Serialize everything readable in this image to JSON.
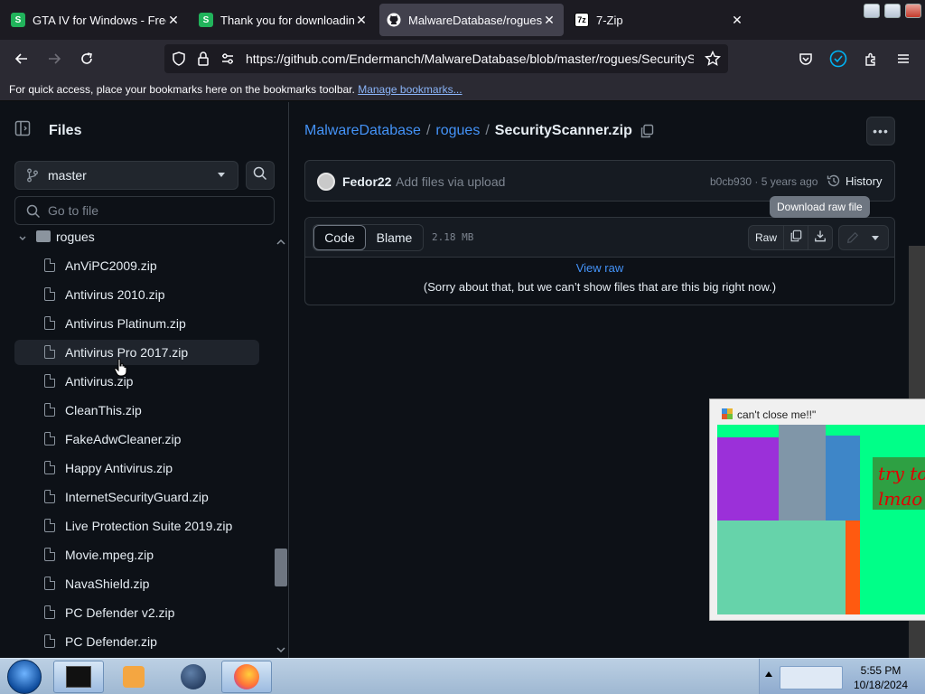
{
  "browser": {
    "tabs": [
      {
        "title": "GTA IV for Windows - Free d",
        "favicon": "s-green",
        "fav_color": "#21b35b"
      },
      {
        "title": "Thank you for downloading",
        "favicon": "s-green",
        "fav_color": "#21b35b"
      },
      {
        "title": "MalwareDatabase/rogues/Se",
        "favicon": "github-icon",
        "active": true
      },
      {
        "title": "7-Zip",
        "favicon": "7zip-icon"
      }
    ],
    "url_main": "https://github.com/Endermanch/MalwareDatabase/blob/master/rogues/SecuritySc",
    "bookmarks_text": "For quick access, place your bookmarks here on the bookmarks toolbar.",
    "bookmarks_link": "Manage bookmarks..."
  },
  "sidebar": {
    "title": "Files",
    "branch": "master",
    "goto_placeholder": "Go to file",
    "folder": "rogues",
    "files": [
      "AnViPC2009.zip",
      "Antivirus 2010.zip",
      "Antivirus Platinum.zip",
      "Antivirus Pro 2017.zip",
      "Antivirus.zip",
      "CleanThis.zip",
      "FakeAdwCleaner.zip",
      "Happy Antivirus.zip",
      "InternetSecurityGuard.zip",
      "Live Protection Suite 2019.zip",
      "Movie.mpeg.zip",
      "NavaShield.zip",
      "PC Defender v2.zip",
      "PC Defender.zip"
    ],
    "hovered_index": 3
  },
  "main": {
    "breadcrumb": {
      "repo": "MalwareDatabase",
      "sep": "/",
      "folder": "rogues",
      "file": "SecurityScanner.zip"
    },
    "commit": {
      "author": "Fedor22",
      "message": "Add files via upload",
      "sha_time": "b0cb930 · 5 years ago",
      "history": "History"
    },
    "tooltip": "Download raw file",
    "file": {
      "tab_code": "Code",
      "tab_blame": "Blame",
      "size": "2.18 MB",
      "raw": "Raw",
      "view_raw": "View raw",
      "too_big": "(Sorry about that, but we can’t show files that are this big right now.)"
    }
  },
  "popup": {
    "title": "can't close me!!\"",
    "text_line1": "try to",
    "text_line2": "lmao"
  },
  "taskbar": {
    "time": "5:55 PM",
    "date": "10/18/2024"
  },
  "colors": {
    "accent_link": "#4493f8",
    "bg": "#0d1117",
    "border": "#30363d",
    "popup_green": "#00ff88"
  }
}
